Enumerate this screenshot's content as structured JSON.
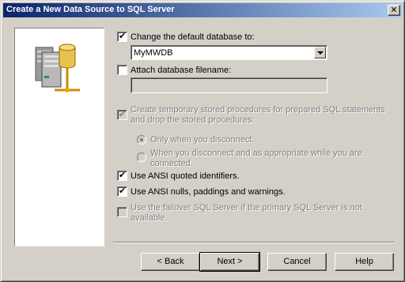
{
  "window": {
    "title": "Create a New Data Source to SQL Server",
    "close_glyph": "✕"
  },
  "options": {
    "change_default_db": {
      "label": "Change the default database to:",
      "checked": true
    },
    "default_db_value": "MyMWDB",
    "attach_db": {
      "label": "Attach database filename:",
      "checked": false
    },
    "attach_filename_value": "",
    "temp_procs": {
      "label_line1": "Create temporary stored procedures for prepared SQL statements",
      "label_line2": "and drop the stored procedures:",
      "checked": true,
      "disabled": true
    },
    "radio_disconnect": {
      "label": "Only when you disconnect.",
      "selected": true
    },
    "radio_appropriate": {
      "label_line1": "When you disconnect and as appropriate while you are",
      "label_line2": "connected.",
      "selected": false
    },
    "ansi_quoted": {
      "label": "Use ANSI quoted identifiers.",
      "checked": true
    },
    "ansi_nulls": {
      "label": "Use ANSI nulls, paddings and warnings.",
      "checked": true
    },
    "failover": {
      "label_line1": "Use the failover SQL Server if the primary SQL Server is not",
      "label_line2": "available.",
      "checked": false,
      "disabled": true
    }
  },
  "buttons": {
    "back": "< Back",
    "next": "Next >",
    "cancel": "Cancel",
    "help": "Help"
  },
  "icons": {
    "server": "server-database-icon",
    "check": "✔"
  },
  "colors": {
    "titlebar_start": "#0a246a",
    "titlebar_end": "#a6caf0",
    "face": "#d4d0c8",
    "disabled_text": "#808080"
  }
}
